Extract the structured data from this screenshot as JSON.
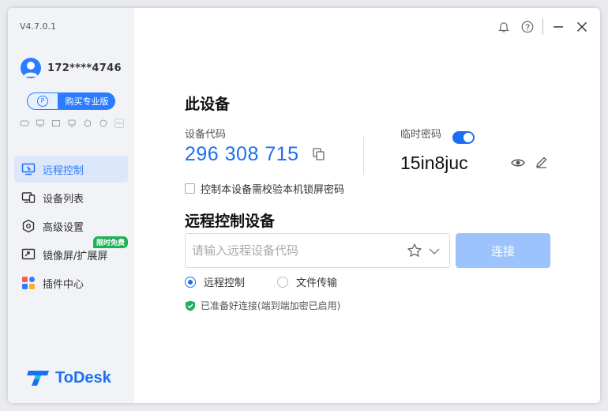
{
  "app": {
    "version": "V4.7.0.1",
    "brand": "ToDesk",
    "accent_color": "#1b6ff5"
  },
  "user": {
    "name": "172****4746",
    "buy_label": "购买专业版"
  },
  "sidebar": {
    "items": [
      {
        "label": "远程控制",
        "icon": "monitor-remote-icon",
        "active": true
      },
      {
        "label": "设备列表",
        "icon": "device-list-icon"
      },
      {
        "label": "高级设置",
        "icon": "hexagon-settings-icon"
      },
      {
        "label": "镜像屏/扩展屏",
        "icon": "screen-mirror-icon",
        "badge": "限时免费"
      },
      {
        "label": "插件中心",
        "icon": "plugin-grid-icon"
      }
    ]
  },
  "this_device": {
    "title": "此设备",
    "code_label": "设备代码",
    "code": "296 308 715",
    "pwd_label": "临时密码",
    "pwd": "15in8juc",
    "pwd_toggle_on": true,
    "lock_checkbox_label": "控制本设备需校验本机锁屏密码"
  },
  "remote": {
    "title": "远程控制设备",
    "input_placeholder": "请输入远程设备代码",
    "connect_label": "连接",
    "mode_remote": "远程控制",
    "mode_file": "文件传输",
    "status": "已准备好连接(端到端加密已启用)"
  }
}
